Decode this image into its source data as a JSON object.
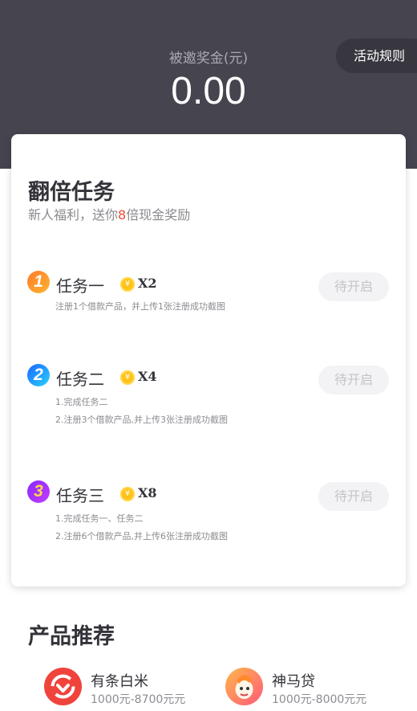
{
  "header": {
    "bonus_label": "被邀奖金(元)",
    "bonus_amount": "0.00",
    "rules_button": "活动规则",
    "bg_color": "#46454f"
  },
  "card": {
    "title": "翻倍任务",
    "subtitle_prefix": "新人福利，送你",
    "subtitle_highlight": "8",
    "subtitle_suffix": "倍现金奖励",
    "highlight_color": "#f04a3a"
  },
  "tasks": [
    {
      "number": "1",
      "name": "任务一",
      "multiplier": "X2",
      "button": "待开启",
      "desc": [
        "注册1个借款产品，并上传1张注册成功截图"
      ]
    },
    {
      "number": "2",
      "name": "任务二",
      "multiplier": "X4",
      "button": "待开启",
      "desc": [
        "1.完成任务二",
        "2.注册3个借款产品,并上传3张注册成功截图"
      ]
    },
    {
      "number": "3",
      "name": "任务三",
      "multiplier": "X8",
      "button": "待开启",
      "desc": [
        "1.完成任务一、任务二",
        "2.注册6个借款产品,并上传6张注册成功截图"
      ]
    }
  ],
  "products_section": {
    "title": "产品推荐",
    "items": [
      {
        "name": "有条白米",
        "range": "1000元-8700元元",
        "icon": "baimi-logo-icon"
      },
      {
        "name": "神马贷",
        "range": "1000元-8000元元",
        "icon": "shenma-logo-icon"
      }
    ]
  },
  "icons": {
    "coin": "coin-icon",
    "yen_symbol": "¥"
  }
}
